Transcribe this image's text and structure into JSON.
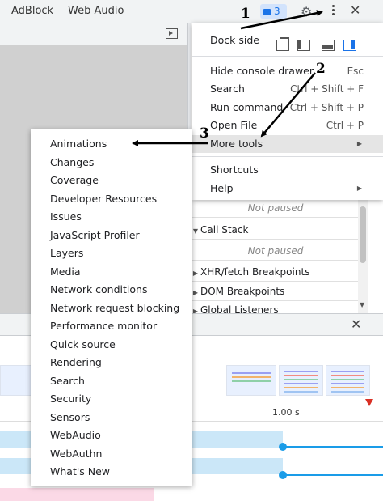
{
  "tabbar": {
    "tabs": [
      "AdBlock",
      "Web Audio"
    ],
    "badge_count": "3",
    "close_glyph": "✕",
    "gear_glyph": "⚙"
  },
  "sources": {
    "rows": [
      {
        "label": "Not paused",
        "muted": true
      },
      {
        "label": "Call Stack",
        "expanded": true
      },
      {
        "label": "Not paused",
        "muted": true
      },
      {
        "label": "XHR/fetch Breakpoints",
        "expanded": false
      },
      {
        "label": "DOM Breakpoints",
        "expanded": false
      },
      {
        "label": "Global Listeners",
        "expanded": false
      }
    ]
  },
  "timeline": {
    "ruler_label": "1.00 s",
    "close_glyph": "✕"
  },
  "main_menu": {
    "dock_side_label": "Dock side",
    "dock_selected": "right",
    "items": [
      {
        "label": "Hide console drawer",
        "shortcut": "Esc"
      },
      {
        "label": "Search",
        "shortcut": "Ctrl + Shift + F"
      },
      {
        "label": "Run command",
        "shortcut": "Ctrl + Shift + P"
      },
      {
        "label": "Open File",
        "shortcut": "Ctrl + P"
      },
      {
        "label": "More tools",
        "submenu": true,
        "highlighted": true
      },
      {
        "label": "Shortcuts"
      },
      {
        "label": "Help",
        "submenu": true
      }
    ]
  },
  "more_tools": [
    "Animations",
    "Changes",
    "Coverage",
    "Developer Resources",
    "Issues",
    "JavaScript Profiler",
    "Layers",
    "Media",
    "Network conditions",
    "Network request blocking",
    "Performance monitor",
    "Quick source",
    "Rendering",
    "Search",
    "Security",
    "Sensors",
    "WebAudio",
    "WebAuthn",
    "What's New"
  ],
  "annotations": [
    "1",
    "2",
    "3"
  ],
  "colors": {
    "accent": "#1a73e8",
    "track": "#cbe7f8",
    "track_line": "#1a9ce8",
    "marker": "#d93025",
    "menu_hover": "#e5e5e5"
  }
}
